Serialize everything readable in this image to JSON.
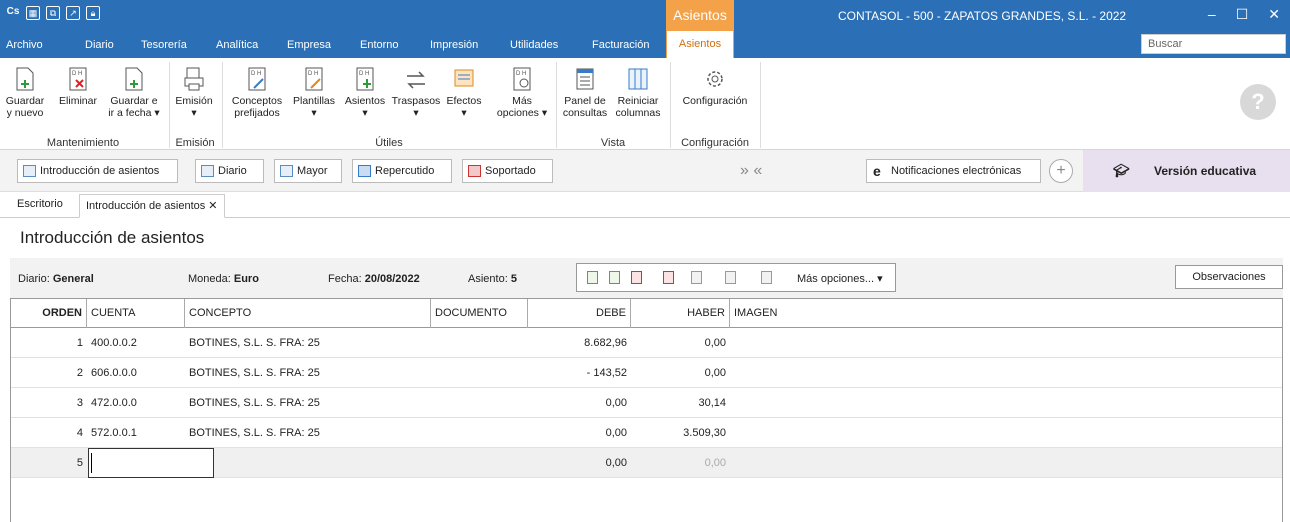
{
  "titlebar": {
    "context_tab": "Asientos",
    "app_title": "CONTASOL - 500 - ZAPATOS GRANDES, S.L. - 2022"
  },
  "menubar": {
    "items": [
      "Archivo",
      "Diario",
      "Tesorería",
      "Analítica",
      "Empresa",
      "Entorno",
      "Impresión",
      "Utilidades",
      "Facturación"
    ],
    "active_tab": "Asientos",
    "search_placeholder": "Buscar"
  },
  "ribbon": {
    "buttons": {
      "guardar_nuevo": [
        "Guardar",
        "y nuevo"
      ],
      "eliminar": [
        "Eliminar",
        ""
      ],
      "guardar_fecha": [
        "Guardar e",
        "ir a fecha ▾"
      ],
      "emision": [
        "Emisión",
        "▾"
      ],
      "conceptos": [
        "Conceptos",
        "prefijados"
      ],
      "plantillas": [
        "Plantillas",
        "▾"
      ],
      "asientos": [
        "Asientos",
        "▾"
      ],
      "traspasos": [
        "Traspasos",
        "▾"
      ],
      "efectos": [
        "Efectos",
        "▾"
      ],
      "mas_opciones": [
        "Más",
        "opciones ▾"
      ],
      "panel": [
        "Panel de",
        "consultas"
      ],
      "reiniciar": [
        "Reiniciar",
        "columnas"
      ],
      "configuracion": [
        "Configuración",
        ""
      ]
    },
    "groups": {
      "mantenimiento": "Mantenimiento",
      "emision": "Emisión",
      "utiles": "Útiles",
      "vista": "Vista",
      "configuracion": "Configuración"
    }
  },
  "shortcuts": {
    "introduccion": "Introducción de asientos",
    "diario": "Diario",
    "mayor": "Mayor",
    "repercutido": "Repercutido",
    "soportado": "Soportado",
    "arrows": "» «",
    "notificaciones": "Notificaciones electrónicas",
    "version": "Versión educativa"
  },
  "doctabs": {
    "escritorio": "Escritorio",
    "active": "Introducción de asientos ✕"
  },
  "page_title": "Introducción de asientos",
  "info": {
    "diario_label": "Diario:",
    "diario_value": "General",
    "moneda_label": "Moneda:",
    "moneda_value": "Euro",
    "fecha_label": "Fecha:",
    "fecha_value": "20/08/2022",
    "asiento_label": "Asiento:",
    "asiento_value": "5",
    "mas_opciones": "Más opciones... ▾",
    "observaciones": "Observaciones"
  },
  "grid": {
    "headers": {
      "orden": "ORDEN",
      "cuenta": "CUENTA",
      "concepto": "CONCEPTO",
      "documento": "DOCUMENTO",
      "debe": "DEBE",
      "haber": "HABER",
      "imagen": "IMAGEN"
    },
    "rows": [
      {
        "orden": "1",
        "cuenta": "400.0.0.2",
        "concepto": "BOTINES, S.L. S. FRA: 25",
        "debe": "8.682,96",
        "haber": "0,00"
      },
      {
        "orden": "2",
        "cuenta": "606.0.0.0",
        "concepto": "BOTINES, S.L. S. FRA: 25",
        "debe": "- 143,52",
        "haber": "0,00"
      },
      {
        "orden": "3",
        "cuenta": "472.0.0.0",
        "concepto": "BOTINES, S.L. S. FRA: 25",
        "debe": "0,00",
        "haber": "30,14"
      },
      {
        "orden": "4",
        "cuenta": "572.0.0.1",
        "concepto": "BOTINES, S.L. S. FRA: 25",
        "debe": "0,00",
        "haber": "3.509,30"
      }
    ],
    "edit_row": {
      "orden": "5",
      "debe": "0,00",
      "haber": "0,00"
    }
  }
}
